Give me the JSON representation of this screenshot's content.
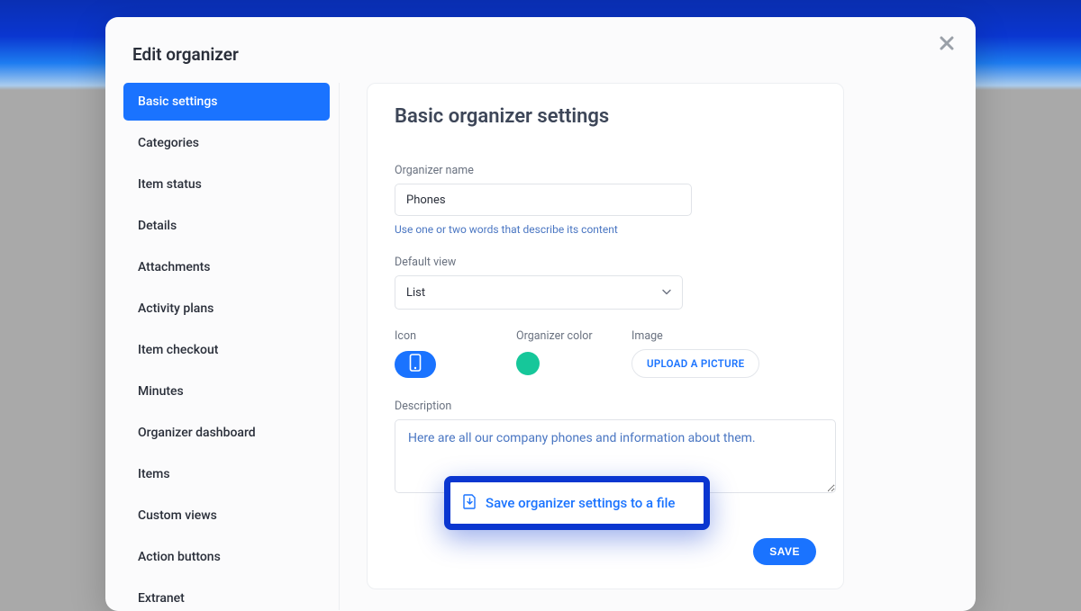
{
  "modal": {
    "title": "Edit organizer"
  },
  "sidebar": {
    "items": [
      {
        "label": "Basic settings",
        "active": true
      },
      {
        "label": "Categories",
        "active": false
      },
      {
        "label": "Item status",
        "active": false
      },
      {
        "label": "Details",
        "active": false
      },
      {
        "label": "Attachments",
        "active": false
      },
      {
        "label": "Activity plans",
        "active": false
      },
      {
        "label": "Item checkout",
        "active": false
      },
      {
        "label": "Minutes",
        "active": false
      },
      {
        "label": "Organizer dashboard",
        "active": false
      },
      {
        "label": "Items",
        "active": false
      },
      {
        "label": "Custom views",
        "active": false
      },
      {
        "label": "Action buttons",
        "active": false
      },
      {
        "label": "Extranet",
        "active": false
      }
    ]
  },
  "panel": {
    "title": "Basic organizer settings",
    "organizer_name_label": "Organizer name",
    "organizer_name_value": "Phones",
    "organizer_name_hint": "Use one or two words that describe its content",
    "default_view_label": "Default view",
    "default_view_value": "List",
    "icon_label": "Icon",
    "icon_name": "phone-icon",
    "color_label": "Organizer color",
    "color_value": "#16c79a",
    "image_label": "Image",
    "upload_label": "UPLOAD A PICTURE",
    "description_label": "Description",
    "description_value": "Here are all our company phones and information about them.",
    "save_button": "SAVE"
  },
  "highlight_link": {
    "label": "Save organizer settings to a file"
  },
  "colors": {
    "primary": "#1a73ff",
    "highlight_border": "#0a36d0"
  }
}
